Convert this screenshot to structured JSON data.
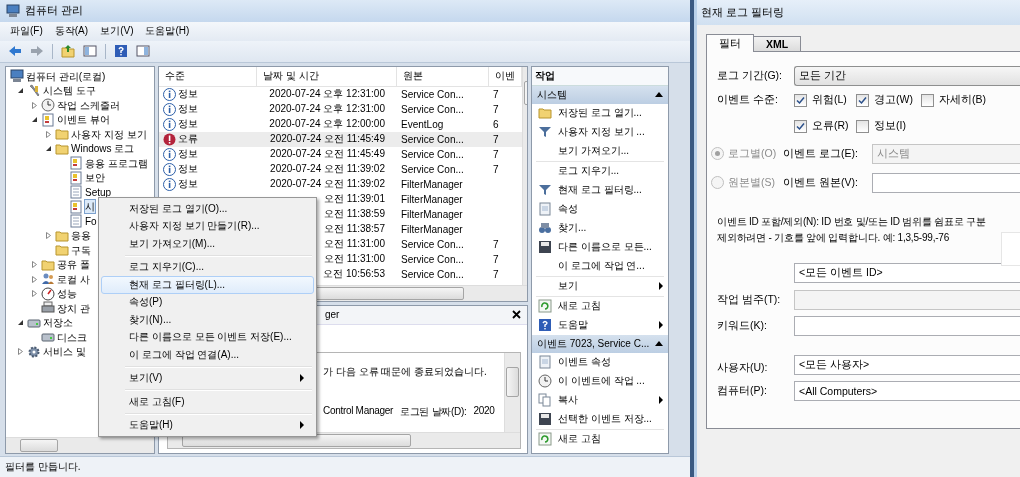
{
  "window": {
    "title": "컴퓨터 관리"
  },
  "menu_bar": [
    "파일(F)",
    "동작(A)",
    "보기(V)",
    "도움말(H)"
  ],
  "tree": [
    {
      "label": "컴퓨터 관리(로컬)",
      "kind": "computer",
      "selected": false,
      "children": [
        {
          "label": "시스템 도구",
          "kind": "tools",
          "expanded": true,
          "selected": false,
          "children": [
            {
              "label": "작업 스케줄러",
              "kind": "clock",
              "expanded": false,
              "selected": false
            },
            {
              "label": "이벤트 뷰어",
              "kind": "viewer",
              "expanded": true,
              "selected": false,
              "children": [
                {
                  "label": "사용자 지정 보기",
                  "kind": "folder",
                  "expanded": false,
                  "selected": false
                },
                {
                  "label": "Windows 로그",
                  "kind": "folder",
                  "expanded": true,
                  "selected": false,
                  "children": [
                    {
                      "label": "응용 프로그램",
                      "kind": "log",
                      "selected": false
                    },
                    {
                      "label": "보안",
                      "kind": "log",
                      "selected": false
                    },
                    {
                      "label": "Setup",
                      "kind": "plainlog",
                      "selected": false
                    },
                    {
                      "label": "시",
                      "kind": "log",
                      "selected": true
                    },
                    {
                      "label": "Fo",
                      "kind": "plainlog",
                      "selected": false
                    }
                  ]
                },
                {
                  "label": "응용",
                  "kind": "folder",
                  "expanded": false,
                  "selected": false
                },
                {
                  "label": "구독",
                  "kind": "folder",
                  "selected": false
                }
              ]
            },
            {
              "label": "공유 폴",
              "kind": "share",
              "expanded": false,
              "selected": false
            },
            {
              "label": "로컬 사",
              "kind": "users",
              "expanded": false,
              "selected": false
            },
            {
              "label": "성능",
              "kind": "perf",
              "expanded": false,
              "selected": false
            },
            {
              "label": "장치 관",
              "kind": "device",
              "selected": false
            }
          ]
        },
        {
          "label": "저장소",
          "kind": "storage",
          "expanded": true,
          "selected": false,
          "children": [
            {
              "label": "디스크",
              "kind": "disk",
              "selected": false
            }
          ]
        },
        {
          "label": "서비스 및",
          "kind": "services",
          "expanded": false,
          "selected": false
        }
      ]
    }
  ],
  "event_list": {
    "columns": [
      "수준",
      "날짜 및 시간",
      "원본",
      "이벤"
    ],
    "rows": [
      {
        "kind": "info",
        "level": "정보",
        "date": "2020-07-24 오후 12:31:00",
        "source": "Service Con...",
        "event_id": "7",
        "selected": false
      },
      {
        "kind": "info",
        "level": "정보",
        "date": "2020-07-24 오후 12:31:00",
        "source": "Service Con...",
        "event_id": "7",
        "selected": false
      },
      {
        "kind": "info",
        "level": "정보",
        "date": "2020-07-24 오후 12:00:00",
        "source": "EventLog",
        "event_id": "6",
        "selected": false
      },
      {
        "kind": "error",
        "level": "오류",
        "date": "2020-07-24 오전 11:45:49",
        "source": "Service Con...",
        "event_id": "7",
        "selected": true
      },
      {
        "kind": "info",
        "level": "정보",
        "date": "2020-07-24 오전 11:45:49",
        "source": "Service Con...",
        "event_id": "7",
        "selected": false
      },
      {
        "kind": "info",
        "level": "정보",
        "date": "2020-07-24 오전 11:39:02",
        "source": "Service Con...",
        "event_id": "7",
        "selected": false
      },
      {
        "kind": "info",
        "level": "정보",
        "date": "2020-07-24 오전 11:39:02",
        "source": "FilterManager",
        "selected": false
      },
      {
        "date": "오전 11:39:01",
        "source": "FilterManager",
        "selected": false
      },
      {
        "date": "오전 11:38:59",
        "source": "FilterManager",
        "selected": false
      },
      {
        "date": "오전 11:38:57",
        "source": "FilterManager",
        "selected": false
      },
      {
        "date": "오전 11:31:00",
        "source": "Service Con...",
        "event_id": "7",
        "selected": false
      },
      {
        "date": "오전 11:31:00",
        "source": "Service Con...",
        "event_id": "7",
        "selected": false
      },
      {
        "date": "오전 10:56:53",
        "source": "Service Con...",
        "event_id": "7",
        "selected": false
      }
    ]
  },
  "event_detail": {
    "title": "ger",
    "message": "가 다음 오류 때문에 종료되었습니다.",
    "source": "Control Manager",
    "logged_label": "로그된 날짜(D):",
    "logged_value": "2020"
  },
  "actions": {
    "title": "작업",
    "sections": [
      {
        "title": "시스템",
        "expanded": true,
        "items": [
          {
            "kind": "open",
            "label": "저장된 로그 열기...",
            "submenu": false
          },
          {
            "kind": "filter",
            "label": "사용자 지정 보기 ...",
            "submenu": false
          },
          {
            "kind": "none",
            "label": "보기 가져오기...",
            "submenu": false
          },
          {
            "kind": "separator"
          },
          {
            "kind": "none",
            "label": "로그 지우기...",
            "submenu": false
          },
          {
            "kind": "filter",
            "label": "현재 로그 필터링...",
            "submenu": false
          },
          {
            "kind": "props",
            "label": "속성",
            "submenu": false
          },
          {
            "kind": "find",
            "label": "찾기...",
            "submenu": false
          },
          {
            "kind": "save",
            "label": "다른 이름으로 모든...",
            "submenu": false
          },
          {
            "kind": "none",
            "label": "이 로그에 작업 연...",
            "submenu": false
          },
          {
            "kind": "separator"
          },
          {
            "kind": "none",
            "label": "보기",
            "submenu": true
          },
          {
            "kind": "separator"
          },
          {
            "kind": "refresh",
            "label": "새로 고침",
            "submenu": false
          },
          {
            "kind": "help",
            "label": "도움말",
            "submenu": true
          }
        ]
      },
      {
        "title": "이벤트 7023, Service C...",
        "expanded": true,
        "items": [
          {
            "kind": "props",
            "label": "이벤트 속성",
            "submenu": false
          },
          {
            "kind": "task",
            "label": "이 이벤트에 작업 ...",
            "submenu": false
          },
          {
            "kind": "copy",
            "label": "복사",
            "submenu": true
          },
          {
            "kind": "save",
            "label": "선택한 이벤트 저장...",
            "submenu": false
          },
          {
            "kind": "separator"
          },
          {
            "kind": "refresh",
            "label": "새로 고침",
            "submenu": false
          }
        ]
      }
    ]
  },
  "context_menu": [
    {
      "kind": "item",
      "label": "저장된 로그 열기(O)...",
      "selected": false,
      "submenu": false
    },
    {
      "kind": "item",
      "label": "사용자 지정 보기 만들기(R)...",
      "selected": false,
      "submenu": false
    },
    {
      "kind": "item",
      "label": "보기 가져오기(M)...",
      "selected": false,
      "submenu": false
    },
    {
      "kind": "separator"
    },
    {
      "kind": "item",
      "label": "로그 지우기(C)...",
      "selected": false,
      "submenu": false
    },
    {
      "kind": "item",
      "label": "현재 로그 필터링(L)...",
      "selected": true,
      "submenu": false
    },
    {
      "kind": "item",
      "label": "속성(P)",
      "selected": false,
      "submenu": false
    },
    {
      "kind": "item",
      "label": "찾기(N)...",
      "selected": false,
      "submenu": false
    },
    {
      "kind": "item",
      "label": "다른 이름으로 모든 이벤트 저장(E)...",
      "selected": false,
      "submenu": false
    },
    {
      "kind": "item",
      "label": "이 로그에 작업 연결(A)...",
      "selected": false,
      "submenu": false
    },
    {
      "kind": "separator"
    },
    {
      "kind": "item",
      "label": "보기(V)",
      "selected": false,
      "submenu": true
    },
    {
      "kind": "separator"
    },
    {
      "kind": "item",
      "label": "새로 고침(F)",
      "selected": false,
      "submenu": false
    },
    {
      "kind": "separator"
    },
    {
      "kind": "item",
      "label": "도움말(H)",
      "selected": false,
      "submenu": true
    }
  ],
  "status_bar": "필터를 만듭니다.",
  "filter_dialog": {
    "title": "현재 로그 필터링",
    "tabs": [
      {
        "label": "필터",
        "selected": true
      },
      {
        "label": "XML",
        "selected": false
      }
    ],
    "period": {
      "label": "로그 기간(G):",
      "value": "모든 기간"
    },
    "levels_label": "이벤트 수준:",
    "levels": [
      {
        "label": "위험(L)",
        "checked": true
      },
      {
        "label": "경고(W)",
        "checked": true
      },
      {
        "label": "자세히(B)",
        "checked": false
      },
      {
        "label": "오류(R)",
        "checked": true
      },
      {
        "label": "정보(I)",
        "checked": false
      }
    ],
    "scopes": [
      {
        "label": "로그별(O)",
        "selected": true,
        "disabled": true,
        "field_label": "이벤트 로그(E):",
        "value": "시스템",
        "field_disabled": true
      },
      {
        "label": "원본별(S)",
        "selected": false,
        "disabled": true,
        "field_label": "이벤트 원본(V):",
        "field_disabled": false
      }
    ],
    "id_help": [
      "이벤트 ID 포함/제외(N): ID 번호 및/또는 ID 범위를 쉼표로 구분",
      "제외하려면 - 기호를 앞에 입력합니다. 예: 1,3,5-99,-76"
    ],
    "id_value": "<모든 이벤트 ID>",
    "fields": [
      {
        "label": "작업 범주(T):",
        "disabled": true
      },
      {
        "label": "키워드(K):",
        "disabled": false
      },
      {
        "label": "사용자(U):",
        "value": "<모든 사용자>",
        "disabled": false
      },
      {
        "label": "컴퓨터(P):",
        "value": "<All Computers>",
        "disabled": false
      }
    ]
  }
}
